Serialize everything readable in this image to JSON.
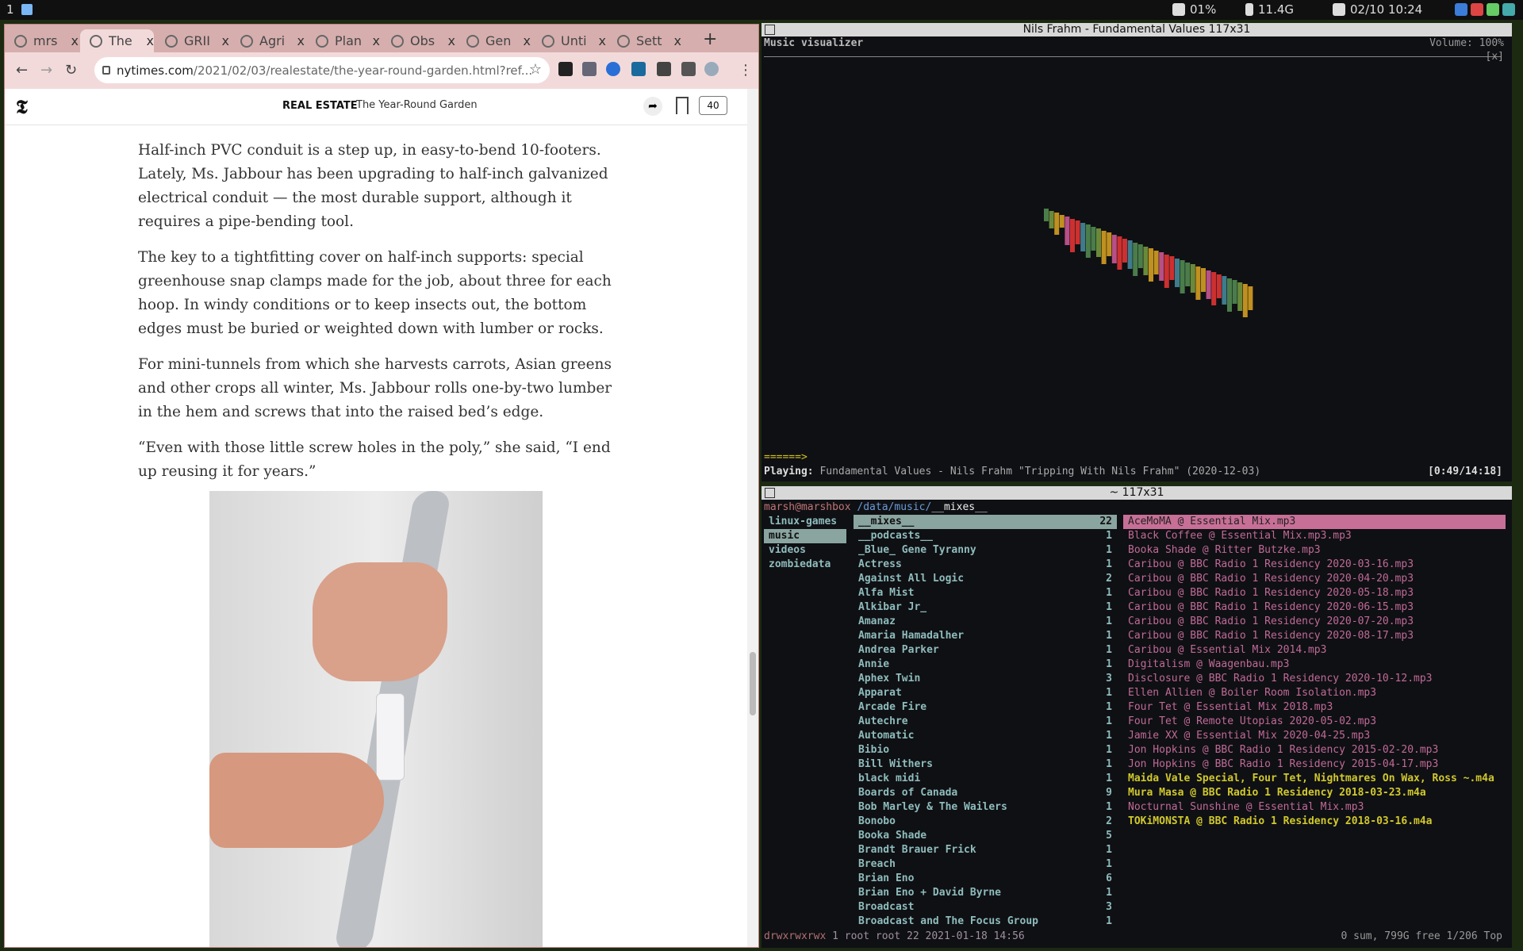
{
  "topbar": {
    "workspace": "1",
    "cpu": "01%",
    "mem": "11.4G",
    "datetime": "02/10 10:24"
  },
  "browser": {
    "tabs": [
      {
        "label": "mrs"
      },
      {
        "label": "The"
      },
      {
        "label": "GRII"
      },
      {
        "label": "Agri"
      },
      {
        "label": "Plan"
      },
      {
        "label": "Obs"
      },
      {
        "label": "Gen"
      },
      {
        "label": "Unti"
      },
      {
        "label": "Sett"
      }
    ],
    "tab_close": "x",
    "newtab": "+",
    "url_host": "nytimes.com",
    "url_path": "/2021/02/03/realestate/the-year-round-garden.html?ref...",
    "nav": {
      "back": "←",
      "forward": "→",
      "reload": "↻",
      "star": "☆",
      "menu": "⋮"
    }
  },
  "nyt": {
    "logo": "𝕿",
    "section": "REAL ESTATE",
    "title": "The Year-Round Garden",
    "comments": "40",
    "paragraphs": [
      "Half-inch PVC conduit is a step up, in easy-to-bend 10-footers. Lately, Ms. Jabbour has been upgrading to half-inch galvanized electrical conduit — the most durable support, although it requires a pipe-bending tool.",
      "The key to a tightfitting cover on half-inch supports: special greenhouse snap clamps made for the job, about three for each hoop. In windy conditions or to keep insects out, the bottom edges must be buried or weighted down with lumber or rocks.",
      "For mini-tunnels from which she harvests carrots, Asian greens and other crops all winter, Ms. Jabbour rolls one-by-two lumber in the hem and screws that into the raised bed’s edge.",
      "“Even with those little screw holes in the poly,” she said, “I end up reusing it for years.”"
    ]
  },
  "visualizer": {
    "window_title": "Nils Frahm - Fundamental Values 117x31",
    "title": "Music visualizer",
    "volume": "Volume: 100%",
    "close": "[x]",
    "progress": "======>",
    "playing_label": "Playing:",
    "now_playing": "Fundamental Values - Nils Frahm \"Tripping With Nils Frahm\" (2020-12-03)",
    "time": "[0:49/14:18]",
    "bar_colors": [
      "#4a7d4a",
      "#3f7b8c",
      "#cc3030",
      "#b84f86",
      "#c09020",
      "#6a8a3a"
    ]
  },
  "filemanager": {
    "window_title": "~ 117x31",
    "prompt_user": "marsh@marshbox",
    "prompt_path": "/data/music/",
    "prompt_dir": "__mixes__",
    "col1": [
      "linux-games",
      "music",
      "videos",
      "zombiedata"
    ],
    "col2": [
      [
        "__mixes__",
        "22"
      ],
      [
        "__podcasts__",
        "1"
      ],
      [
        "_Blue_ Gene Tyranny",
        "1"
      ],
      [
        "Actress",
        "1"
      ],
      [
        "Against All Logic",
        "2"
      ],
      [
        "Alfa Mist",
        "1"
      ],
      [
        "Alkibar Jr_",
        "1"
      ],
      [
        "Amanaz",
        "1"
      ],
      [
        "Amaria Hamadalher",
        "1"
      ],
      [
        "Andrea Parker",
        "1"
      ],
      [
        "Annie",
        "1"
      ],
      [
        "Aphex Twin",
        "3"
      ],
      [
        "Apparat",
        "1"
      ],
      [
        "Arcade Fire",
        "1"
      ],
      [
        "Autechre",
        "1"
      ],
      [
        "Automatic",
        "1"
      ],
      [
        "Bibio",
        "1"
      ],
      [
        "Bill Withers",
        "1"
      ],
      [
        "black midi",
        "1"
      ],
      [
        "Boards of Canada",
        "9"
      ],
      [
        "Bob Marley & The Wailers",
        "1"
      ],
      [
        "Bonobo",
        "2"
      ],
      [
        "Booka Shade",
        "5"
      ],
      [
        "Brandt Brauer Frick",
        "1"
      ],
      [
        "Breach",
        "1"
      ],
      [
        "Brian Eno",
        "6"
      ],
      [
        "Brian Eno + David Byrne",
        "1"
      ],
      [
        "Broadcast",
        "3"
      ],
      [
        "Broadcast and The Focus Group",
        "1"
      ]
    ],
    "col3": [
      "AceMoMA @ Essential Mix.mp3",
      "Black Coffee @ Essential Mix.mp3.mp3",
      "Booka Shade @ Ritter Butzke.mp3",
      "Caribou @ BBC Radio 1 Residency 2020-03-16.mp3",
      "Caribou @ BBC Radio 1 Residency 2020-04-20.mp3",
      "Caribou @ BBC Radio 1 Residency 2020-05-18.mp3",
      "Caribou @ BBC Radio 1 Residency 2020-06-15.mp3",
      "Caribou @ BBC Radio 1 Residency 2020-07-20.mp3",
      "Caribou @ BBC Radio 1 Residency 2020-08-17.mp3",
      "Caribou @ Essential Mix 2014.mp3",
      "Digitalism @ Waagenbau.mp3",
      "Disclosure @ BBC Radio 1 Residency 2020-10-12.mp3",
      "Ellen Allien @ Boiler Room Isolation.mp3",
      "Four Tet @ Essential Mix 2018.mp3",
      "Four Tet @ Remote Utopias 2020-05-02.mp3",
      "Jamie XX @ Essential Mix 2020-04-25.mp3",
      "Jon Hopkins @ BBC Radio 1 Residency 2015-02-20.mp3",
      "Jon Hopkins @ BBC Radio 1 Residency 2015-04-17.mp3",
      "Maida Vale Special, Four Tet, Nightmares On Wax, Ross ~.m4a",
      "Mura Masa @ BBC Radio 1 Residency 2018-03-23.m4a",
      "Nocturnal Sunshine @ Essential Mix.mp3",
      "TOKiMONSTA @ BBC Radio 1 Residency 2018-03-16.m4a"
    ],
    "status_perm": "drwxrwxrwx",
    "status_rest": " 1 root root 22 2021-01-18 14:56",
    "status_right": "0 sum, 799G free  1/206  Top"
  }
}
